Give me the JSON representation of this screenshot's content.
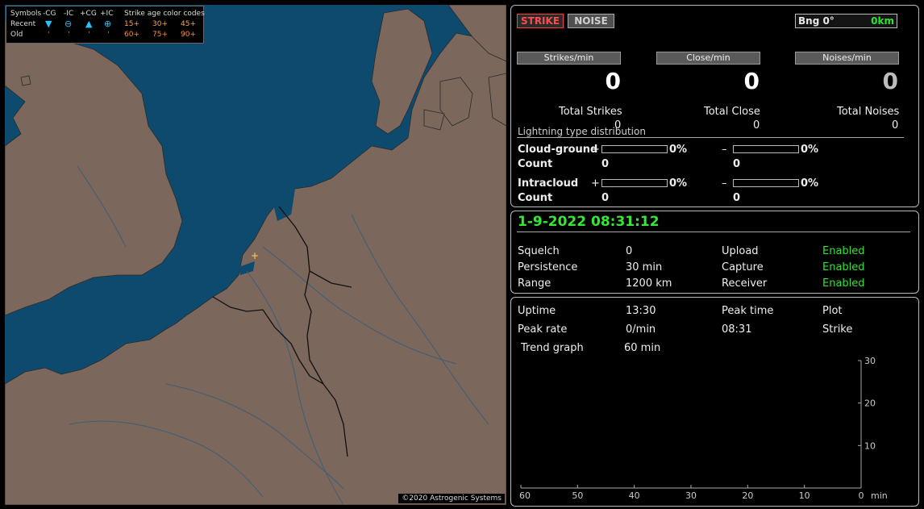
{
  "legend": {
    "symbols_label": "Symbols",
    "cg_neg": "-CG",
    "ic_neg": "-IC",
    "cg_pos": "+CG",
    "ic_pos": "+IC",
    "age_label": "Strike age color codes",
    "recent_label": "Recent",
    "old_label": "Old",
    "recent_ages": [
      "15+",
      "30+",
      "45+"
    ],
    "old_ages": [
      "60+",
      "75+",
      "90+"
    ],
    "colors": {
      "symbol": "#27c4ff",
      "age": "#ffa64d"
    }
  },
  "map": {
    "copyright": "©2020 Astrogenic Systems",
    "colors": {
      "sea": "#0e4a6e",
      "land": "#7b675c"
    }
  },
  "toolbar": {
    "strike_label": "STRIKE",
    "noise_label": "NOISE",
    "bearing_label": "Bng 0°",
    "distance_label": "0km"
  },
  "rates": {
    "strikes_label": "Strikes/min",
    "close_label": "Close/min",
    "noises_label": "Noises/min",
    "strikes_value": "0",
    "close_value": "0",
    "noises_value": "0"
  },
  "totals": {
    "strikes_label": "Total Strikes",
    "close_label": "Total Close",
    "noises_label": "Total Noises",
    "strikes_value": "0",
    "close_value": "0",
    "noises_value": "0"
  },
  "distribution": {
    "title": "Lightning type distribution",
    "cg_label": "Cloud-ground",
    "ic_label": "Intracloud",
    "count_label": "Count",
    "plus": "+",
    "minus": "–",
    "cg_pos_pct": "0%",
    "cg_neg_pct": "0%",
    "ic_pos_pct": "0%",
    "ic_neg_pct": "0%",
    "cg_pos_count": "0",
    "cg_neg_count": "0",
    "ic_pos_count": "0",
    "ic_neg_count": "0",
    "cg_pos_fill": 0,
    "cg_neg_fill": 0,
    "ic_pos_fill": 0,
    "ic_neg_fill": 0
  },
  "status": {
    "datetime": "1-9-2022 08:31:12",
    "squelch_label": "Squelch",
    "squelch_value": "0",
    "persistence_label": "Persistence",
    "persistence_value": "30 min",
    "range_label": "Range",
    "range_value": "1200 km",
    "upload_label": "Upload",
    "upload_value": "Enabled",
    "capture_label": "Capture",
    "capture_value": "Enabled",
    "receiver_label": "Receiver",
    "receiver_value": "Enabled",
    "enabled_color": "#2ee32e"
  },
  "stats": {
    "uptime_label": "Uptime",
    "uptime_value": "13:30",
    "peak_time_label": "Peak time",
    "peak_time_value": "08:31",
    "plot_label": "Plot",
    "plot_value": "Strike",
    "peak_rate_label": "Peak rate",
    "peak_rate_value": "0/min",
    "trend_label": "Trend graph",
    "trend_value": "60 min"
  },
  "chart_data": {
    "type": "line",
    "x_ticks": [
      "60",
      "50",
      "40",
      "30",
      "20",
      "10",
      "0"
    ],
    "y_ticks": [
      "30",
      "20",
      "10"
    ],
    "x_unit": "min",
    "xlim": [
      60,
      0
    ],
    "ylim": [
      0,
      30
    ],
    "series": []
  }
}
